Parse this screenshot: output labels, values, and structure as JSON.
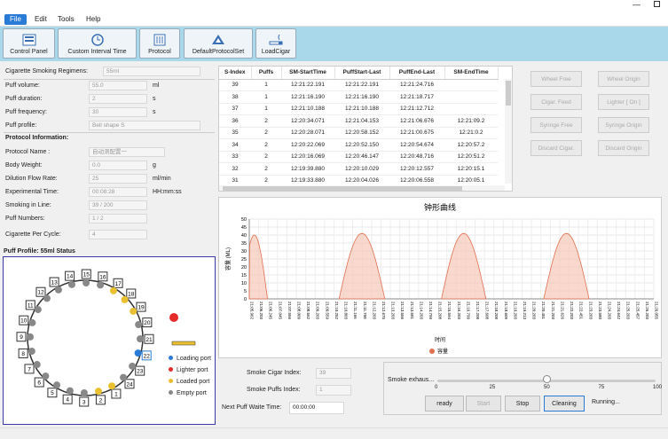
{
  "menu": {
    "items": [
      "File",
      "Edit",
      "Tools",
      "Help"
    ]
  },
  "toolbar": {
    "buttons": [
      "Control Panel",
      "Custom Interval Time",
      "Protocol",
      "DefaultProtocolSet",
      "LoadCigar"
    ]
  },
  "params": {
    "regimen_label": "Cigarette Smoking Regimens:",
    "regimen_value": "55ml",
    "puff_volume_label": "Puff volume:",
    "puff_volume": "55.0",
    "puff_volume_unit": "ml",
    "puff_duration_label": "Puff duration:",
    "puff_duration": "2",
    "puff_duration_unit": "s",
    "puff_frequency_label": "Puff frequency:",
    "puff_frequency": "30",
    "puff_frequency_unit": "s",
    "puff_profile_label": "Puff profile:",
    "puff_profile": "Bell shape S"
  },
  "protocol": {
    "title": "Protocol Information:",
    "name_label": "Protocol Name :",
    "name_value": "自动测配置一",
    "weight_label": "Body  Weight:",
    "weight_value": "0.0",
    "weight_unit": "g",
    "dilution_label": "Dilution Flow Rate:",
    "dilution_value": "25",
    "dilution_unit": "ml/min",
    "exptime_label": "Experimental Time:",
    "exptime_value": "00:08:28",
    "exptime_unit": "HH:mm:ss",
    "inline_label": "Smoking in Line:",
    "inline_value": "39  /  200",
    "puffnum_label": "Puff Numbers:",
    "puffnum_value": "1  /  2",
    "percycle_label": "Cigarette Per Cycle:",
    "percycle_value": "4"
  },
  "profile_status": {
    "title": "Puff Profile: 55ml Status",
    "legend": [
      "Loading port",
      "Lighter port",
      "Loaded port",
      "Empty port"
    ],
    "colors": {
      "loading": "#2a7bd6",
      "lighter": "#e52a2a",
      "loaded": "#e8c030",
      "empty": "#888888"
    }
  },
  "table": {
    "headers": [
      "S-Index",
      "Puffs",
      "SM-StartTime",
      "PuffStart-Last",
      "PuffEnd-Last",
      "SM-EndTime"
    ],
    "rows": [
      [
        "39",
        "1",
        "12:21:22.191",
        "12:21:22.191",
        "12:21:24.716",
        ""
      ],
      [
        "38",
        "1",
        "12:21:16.190",
        "12:21:16.190",
        "12:21:18.717",
        ""
      ],
      [
        "37",
        "1",
        "12:21:10.188",
        "12:21:10.188",
        "12:21:12.712",
        ""
      ],
      [
        "36",
        "2",
        "12:20:34.071",
        "12:21:04.153",
        "12:21:06.676",
        "12:21:09.2"
      ],
      [
        "35",
        "2",
        "12:20:28.071",
        "12:20:58.152",
        "12:21:00.675",
        "12:21:0.2"
      ],
      [
        "34",
        "2",
        "12:20:22.069",
        "12:20:52.150",
        "12:20:54.674",
        "12:20:57.2"
      ],
      [
        "33",
        "2",
        "12:20:16.069",
        "12:20:46.147",
        "12:20:48.716",
        "12:20:51.2"
      ],
      [
        "32",
        "2",
        "12:19:39.880",
        "12:20:10.029",
        "12:20:12.557",
        "12:20:15.1"
      ],
      [
        "31",
        "2",
        "12:19:33.880",
        "12:20:04.026",
        "12:20:06.558",
        "12:20:05.1"
      ]
    ]
  },
  "right_buttons": [
    "Wheel Free",
    "Wheel Origin",
    "Cigar. Feed",
    "Lighter [ On ]",
    "Syringe Free",
    "Syringe Origin",
    "Discard Cigar.",
    "Discard Origin"
  ],
  "chart_data": {
    "type": "area",
    "title": "钟形曲线",
    "ylabel": "容量 (ML)",
    "xlabel": "时间",
    "legend": "容量",
    "ylim": [
      0,
      50
    ],
    "yticks": [
      0,
      5,
      10,
      15,
      20,
      25,
      30,
      35,
      40,
      45,
      50
    ],
    "xticks": [
      "21:05.962",
      "21:06.203",
      "21:06.245",
      "21:07.045",
      "21:07.556",
      "21:08.009",
      "21:08.562",
      "21:09.203",
      "21:09.559",
      "21:10.252",
      "21:10.803",
      "21:11.166",
      "21:11.758",
      "21:12.203",
      "21:12.675",
      "21:13.203",
      "21:13.556",
      "21:13.581",
      "21:14.203",
      "21:14.799",
      "21:15.208",
      "21:15.594",
      "21:16.203",
      "21:16.799",
      "21:17.208",
      "21:17.608",
      "21:18.208",
      "21:18.609",
      "21:19.203",
      "21:19.213",
      "21:20.203",
      "21:20.451",
      "21:21.203",
      "21:21.626",
      "21:22.203",
      "21:22.451",
      "21:23.203",
      "21:23.580",
      "21:24.203",
      "21:24.642",
      "21:25.203",
      "21:25.457",
      "21:26.203",
      "21:26.055"
    ],
    "peaks": [
      {
        "start": -0.02,
        "end": 0.045,
        "max": 40
      },
      {
        "start": 0.222,
        "end": 0.335,
        "max": 41
      },
      {
        "start": 0.475,
        "end": 0.585,
        "max": 41
      },
      {
        "start": 0.728,
        "end": 0.84,
        "max": 41
      }
    ]
  },
  "bottom": {
    "cigar_index_label": "Smoke Cigar Index:",
    "cigar_index": "39",
    "puffs_index_label": "Smoke Puffs Index:",
    "puffs_index": "1",
    "wait_label": "Next Puff Waite Time:",
    "wait_value": "00:00:00"
  },
  "control": {
    "exhaust_label": "Smoke exhaus...",
    "slider_value": 50,
    "slider_ticks": [
      "0",
      "25",
      "50",
      "75",
      "100"
    ],
    "buttons": [
      "ready",
      "Start",
      "Stop",
      "Cleaning"
    ],
    "status": "Running..."
  },
  "ports": [
    {
      "n": "14",
      "s": "empty"
    },
    {
      "n": "15",
      "s": "empty"
    },
    {
      "n": "16",
      "s": "empty"
    },
    {
      "n": "17",
      "s": "loaded"
    },
    {
      "n": "18",
      "s": "loaded"
    },
    {
      "n": "19",
      "s": "loaded"
    },
    {
      "n": "20",
      "s": "empty"
    },
    {
      "n": "21",
      "s": "empty"
    },
    {
      "n": "22",
      "s": "loading"
    },
    {
      "n": "23",
      "s": "empty"
    },
    {
      "n": "24",
      "s": "empty"
    },
    {
      "n": "1",
      "s": "loaded"
    },
    {
      "n": "2",
      "s": "loaded"
    },
    {
      "n": "3",
      "s": "empty"
    },
    {
      "n": "4",
      "s": "empty"
    },
    {
      "n": "5",
      "s": "empty"
    },
    {
      "n": "6",
      "s": "empty"
    },
    {
      "n": "7",
      "s": "empty"
    },
    {
      "n": "8",
      "s": "empty"
    },
    {
      "n": "9",
      "s": "empty"
    },
    {
      "n": "10",
      "s": "empty"
    },
    {
      "n": "11",
      "s": "empty"
    },
    {
      "n": "12",
      "s": "empty"
    },
    {
      "n": "13",
      "s": "empty"
    }
  ]
}
